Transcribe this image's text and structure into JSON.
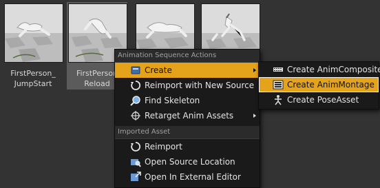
{
  "assets": [
    {
      "label": "FirstPerson_\nJumpStart",
      "selected": false
    },
    {
      "label": "FirstPerson\nReload",
      "selected": true
    },
    {
      "label": "",
      "selected": false
    },
    {
      "label": "",
      "selected": false
    }
  ],
  "context_menu": {
    "section_1": "Animation Sequence Actions",
    "create": "Create",
    "reimport_new": "Reimport with New Source",
    "find_skeleton": "Find Skeleton",
    "retarget": "Retarget Anim Assets",
    "section_2": "Imported Asset",
    "reimport": "Reimport",
    "open_source": "Open Source Location",
    "open_external": "Open In External Editor"
  },
  "submenu": {
    "anim_composite": "Create AnimComposite",
    "anim_montage": "Create AnimMontage",
    "pose_asset": "Create PoseAsset"
  },
  "colors": {
    "highlight": "#e5a21b",
    "menu_bg": "#1a1a1a",
    "browser_bg": "#333333"
  }
}
